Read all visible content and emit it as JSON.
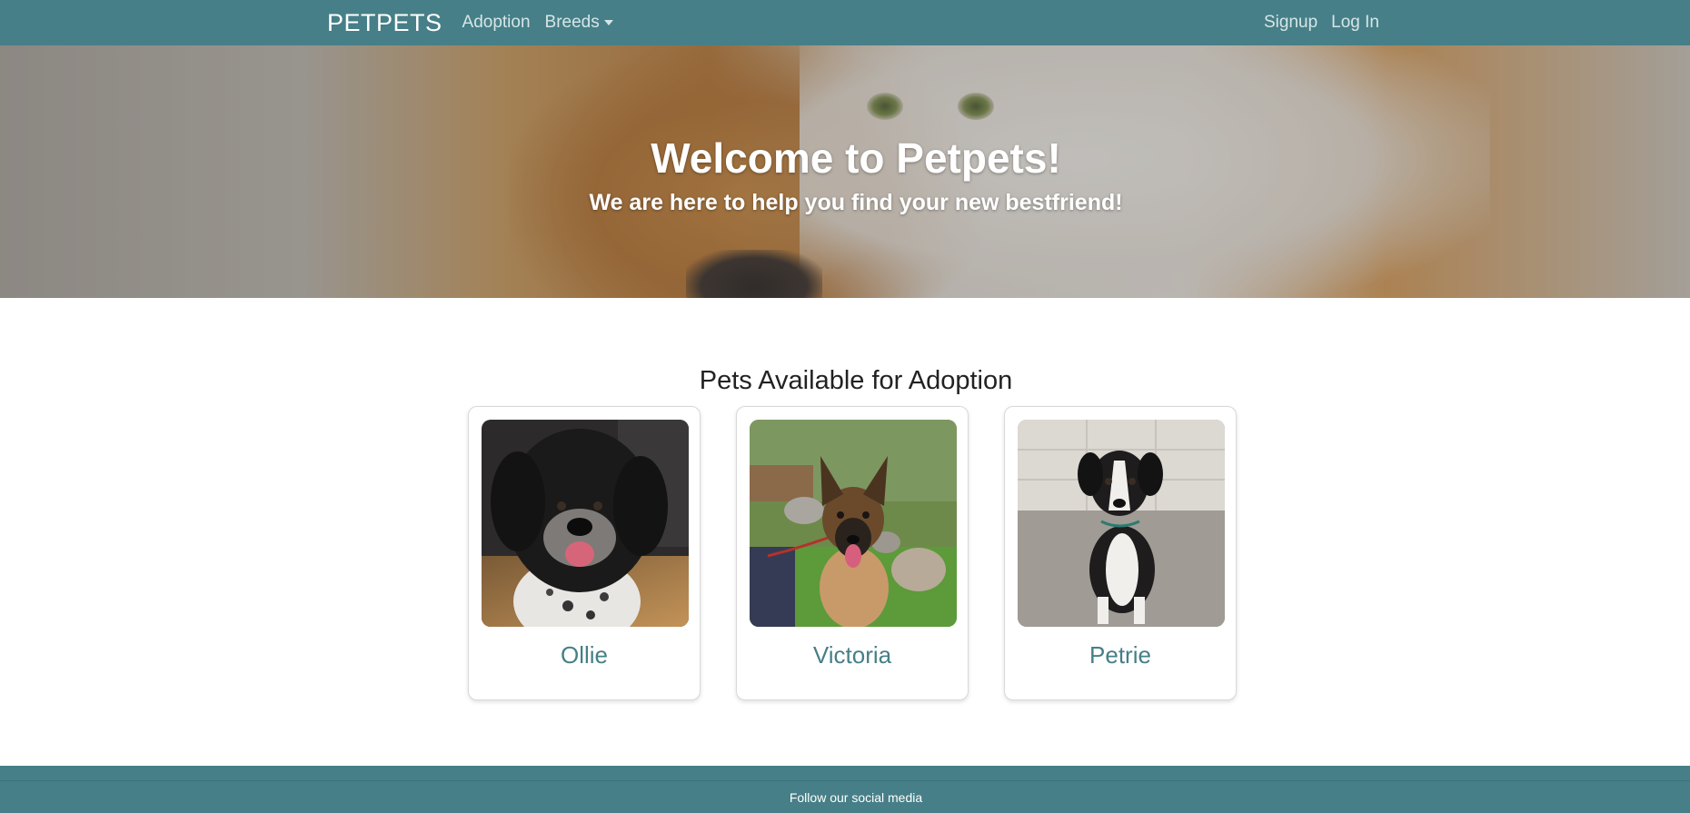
{
  "navbar": {
    "brand": "PETPETS",
    "links": {
      "adoption": "Adoption",
      "breeds": "Breeds",
      "signup": "Signup",
      "login": "Log In"
    },
    "background": "#467f87"
  },
  "hero": {
    "title": "Welcome to Petpets!",
    "subtitle": "We are here to help you find your new bestfriend!"
  },
  "adoption": {
    "heading": "Pets Available for Adoption",
    "pets": [
      {
        "name": "Ollie"
      },
      {
        "name": "Victoria"
      },
      {
        "name": "Petrie"
      }
    ]
  },
  "footer": {
    "text": "Follow our social media"
  },
  "colors": {
    "accent": "#467f87",
    "pet_name": "#467f87"
  }
}
